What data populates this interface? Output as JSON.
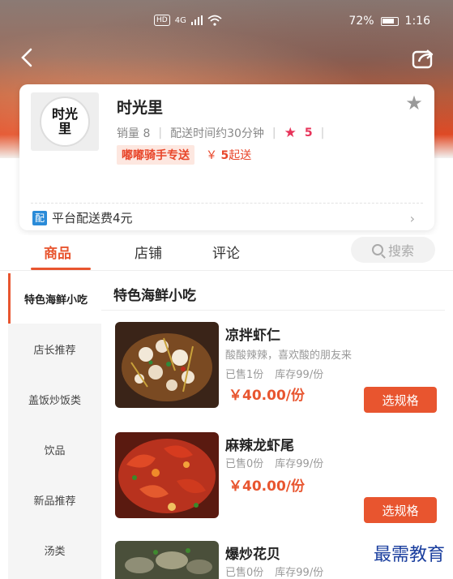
{
  "status_bar": {
    "hd": "HD",
    "network": "4G",
    "battery_percent": "72%",
    "time": "1:16"
  },
  "header": {
    "back_icon": "chevron-left-icon",
    "share_icon": "share-icon"
  },
  "shop": {
    "logo_text_top": "时光",
    "logo_text_bottom": "里",
    "name": "时光里",
    "sales": "销量 8",
    "delivery_time": "配送时间约30分钟",
    "rating": "5",
    "rider_tag": "嘟嘟骑手专送",
    "min_order_symbol": "￥",
    "min_order_value": "5",
    "min_order_suffix": "起送",
    "delivery_badge": "配",
    "delivery_fee": "平台配送费4元",
    "colors": {
      "accent": "#e8552f",
      "rating": "#e7345a",
      "badge": "#2a8bd8"
    }
  },
  "tabs": {
    "items": [
      "商品",
      "店铺",
      "评论"
    ],
    "active": "商品",
    "search_label": "搜索"
  },
  "sidebar": {
    "items": [
      "特色海鲜小吃",
      "店长推荐",
      "盖饭炒饭类",
      "饮品",
      "新品推荐",
      "汤类"
    ],
    "active_index": 0
  },
  "section": {
    "title": "特色海鲜小吃"
  },
  "products": [
    {
      "name": "凉拌虾仁",
      "desc": "酸酸辣辣，喜欢酸的朋友来",
      "sold": "已售1份",
      "stock": "库存99/份",
      "price": "￥40.00/份",
      "button": "选规格"
    },
    {
      "name": "麻辣龙虾尾",
      "desc": "",
      "sold": "已售0份",
      "stock": "库存99/份",
      "price": "￥40.00/份",
      "button": "选规格"
    },
    {
      "name": "爆炒花贝",
      "desc": "",
      "sold": "已售0份",
      "stock": "库存99/份",
      "price": "",
      "button": ""
    }
  ],
  "watermark": "最需教育"
}
